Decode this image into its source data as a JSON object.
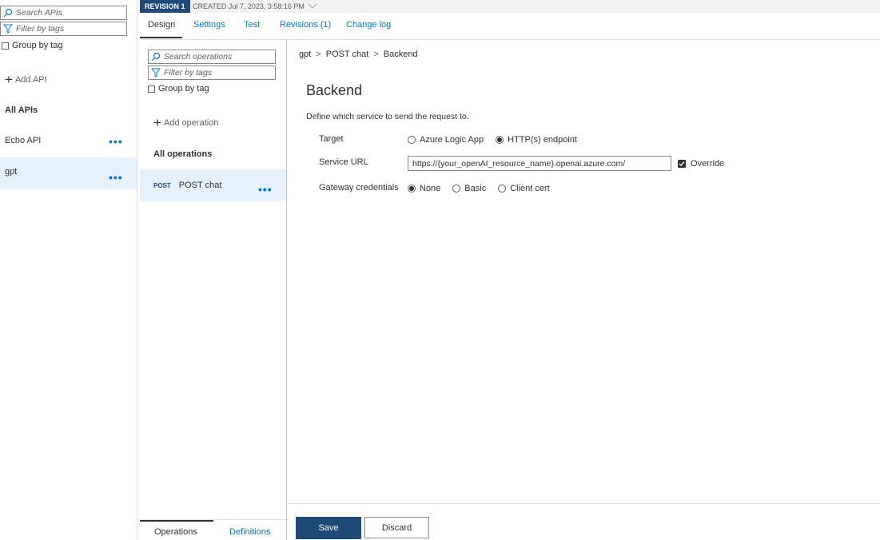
{
  "api_pane": {
    "search_placeholder": "Search APIs",
    "filter_placeholder": "Filter by tags",
    "group_by_tag": "Group by tag",
    "add_api": "Add API",
    "section_title": "All APIs",
    "apis": [
      {
        "label": "Echo API",
        "selected": false
      },
      {
        "label": "gpt",
        "selected": true
      }
    ]
  },
  "revision": {
    "badge": "REVISION 1",
    "created": "CREATED Jul 7, 2023, 3:58:16 PM"
  },
  "tabs": [
    "Design",
    "Settings",
    "Test",
    "Revisions (1)",
    "Change log"
  ],
  "operations_pane": {
    "search_placeholder": "Search operations",
    "filter_placeholder": "Filter by tags",
    "group_by_tag": "Group by tag",
    "add_operation": "Add operation",
    "section_title": "All operations",
    "operations": [
      {
        "method": "POST",
        "name": "POST chat",
        "selected": true
      }
    ],
    "bottom_tabs": [
      "Operations",
      "Definitions"
    ]
  },
  "main": {
    "breadcrumb": [
      "gpt",
      "POST chat",
      "Backend"
    ],
    "breadcrumb_sep": ">",
    "title": "Backend",
    "description": "Define which service to send the request to.",
    "target": {
      "label": "Target",
      "options": [
        "Azure Logic App",
        "HTTP(s) endpoint"
      ],
      "selected": "HTTP(s) endpoint"
    },
    "service_url": {
      "label": "Service URL",
      "value": "https://{your_openAI_resource_name}.openai.azure.com/",
      "override_label": "Override",
      "override_checked": true
    },
    "gateway_credentials": {
      "label": "Gateway credentials",
      "options": [
        "None",
        "Basic",
        "Client cert"
      ],
      "selected": "None"
    },
    "save_label": "Save",
    "discard_label": "Discard"
  },
  "colors": {
    "accent": "#0078d4",
    "primary_button": "#1e4a7a",
    "selected_row": "#e5f1fb"
  }
}
